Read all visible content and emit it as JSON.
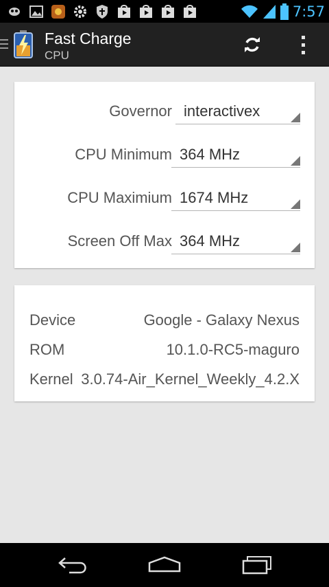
{
  "status_bar": {
    "time": "7:57",
    "icons": [
      "app-notification-icon",
      "gallery-icon",
      "widget-icon",
      "settings-icon",
      "shield-icon",
      "play-store-icon",
      "play-store-icon",
      "play-store-icon",
      "play-store-icon",
      "wifi-icon",
      "signal-icon",
      "battery-icon"
    ]
  },
  "action_bar": {
    "title": "Fast Charge",
    "subtitle": "CPU",
    "actions": [
      "refresh-icon",
      "overflow-menu-icon"
    ]
  },
  "cpu_settings": [
    {
      "label": "Governor",
      "value": "interactivex"
    },
    {
      "label": "CPU Minimum",
      "value": "364 MHz"
    },
    {
      "label": "CPU Maximium",
      "value": "1674 MHz"
    },
    {
      "label": "Screen Off Max",
      "value": "364 MHz"
    }
  ],
  "device_info": [
    {
      "label": "Device",
      "value": "Google - Galaxy Nexus"
    },
    {
      "label": "ROM",
      "value": "10.1.0-RC5-maguro"
    },
    {
      "label": "Kernel",
      "value": "3.0.74-Air_Kernel_Weekly_4.2.X"
    }
  ],
  "nav_bar": {
    "buttons": [
      "back-icon",
      "home-icon",
      "recent-apps-icon"
    ]
  },
  "colors": {
    "clock": "#4cc3ff",
    "action_bar": "#212121",
    "background": "#e6e6e6"
  }
}
